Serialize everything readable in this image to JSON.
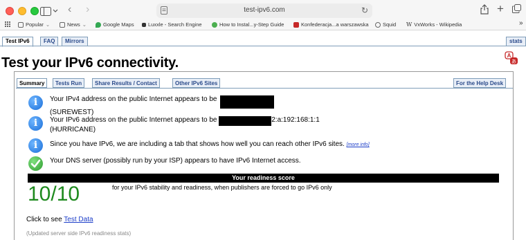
{
  "browser": {
    "address": "test-ipv6.com",
    "favorites": [
      {
        "label": "Popular",
        "icon": "grid-icon"
      },
      {
        "label": "News",
        "icon": "newspaper-icon"
      },
      {
        "label": "Google Maps",
        "icon": "map-pin-icon"
      },
      {
        "label": "Luxxle - Search Engine",
        "icon": "luxxle-icon"
      },
      {
        "label": "How to Instal...y-Step Guide",
        "icon": "guide-icon"
      },
      {
        "label": "Konfederacja...a warszawska",
        "icon": "konfederacja-icon"
      },
      {
        "label": "Squid",
        "icon": "globe-icon"
      },
      {
        "label": "VxWorks - Wikipedia",
        "icon": "wikipedia-icon"
      }
    ],
    "overflow_label": "»"
  },
  "top_tabs": [
    {
      "label": "Test IPv6",
      "active": true
    },
    {
      "label": "FAQ",
      "active": false
    },
    {
      "label": "Mirrors",
      "active": false
    }
  ],
  "stats_tab": "stats",
  "page_title": "Test your IPv6 connectivity.",
  "sub_tabs": [
    {
      "label": "Summary",
      "active": true
    },
    {
      "label": "Tests Run",
      "active": false
    },
    {
      "label": "Share Results / Contact",
      "active": false
    },
    {
      "label": "Other IPv6 Sites",
      "active": false
    }
  ],
  "help_desk_tab": "For the Help Desk",
  "results": {
    "ipv4": {
      "text": "Your IPv4 address on the public Internet appears to be",
      "isp": "(SUREWEST)"
    },
    "ipv6": {
      "text": "Your IPv6 address on the public Internet appears to be",
      "suffix": "2:a:192:168:1:1",
      "isp": "(HURRICANE)"
    },
    "tab_note": {
      "text": "Since you have IPv6, we are including a tab that shows how well you can reach other IPv6 sites.",
      "link": "[more info]"
    },
    "dns": {
      "text": "Your DNS server (possibly run by your ISP) appears to have IPv6 Internet access."
    }
  },
  "readiness": {
    "header": "Your readiness score",
    "score": "10/10",
    "description": "for your IPv6 stability and readiness, when publishers are forced to go IPv6 only"
  },
  "test_data": {
    "prefix": "Click to see",
    "link": "Test Data"
  },
  "updated_note": "(Updated server side IPv6 readiness stats)",
  "colors": {
    "score_green": "#1e8a1e",
    "tab_border": "#7f9db9",
    "link": "#1a3cc8"
  }
}
